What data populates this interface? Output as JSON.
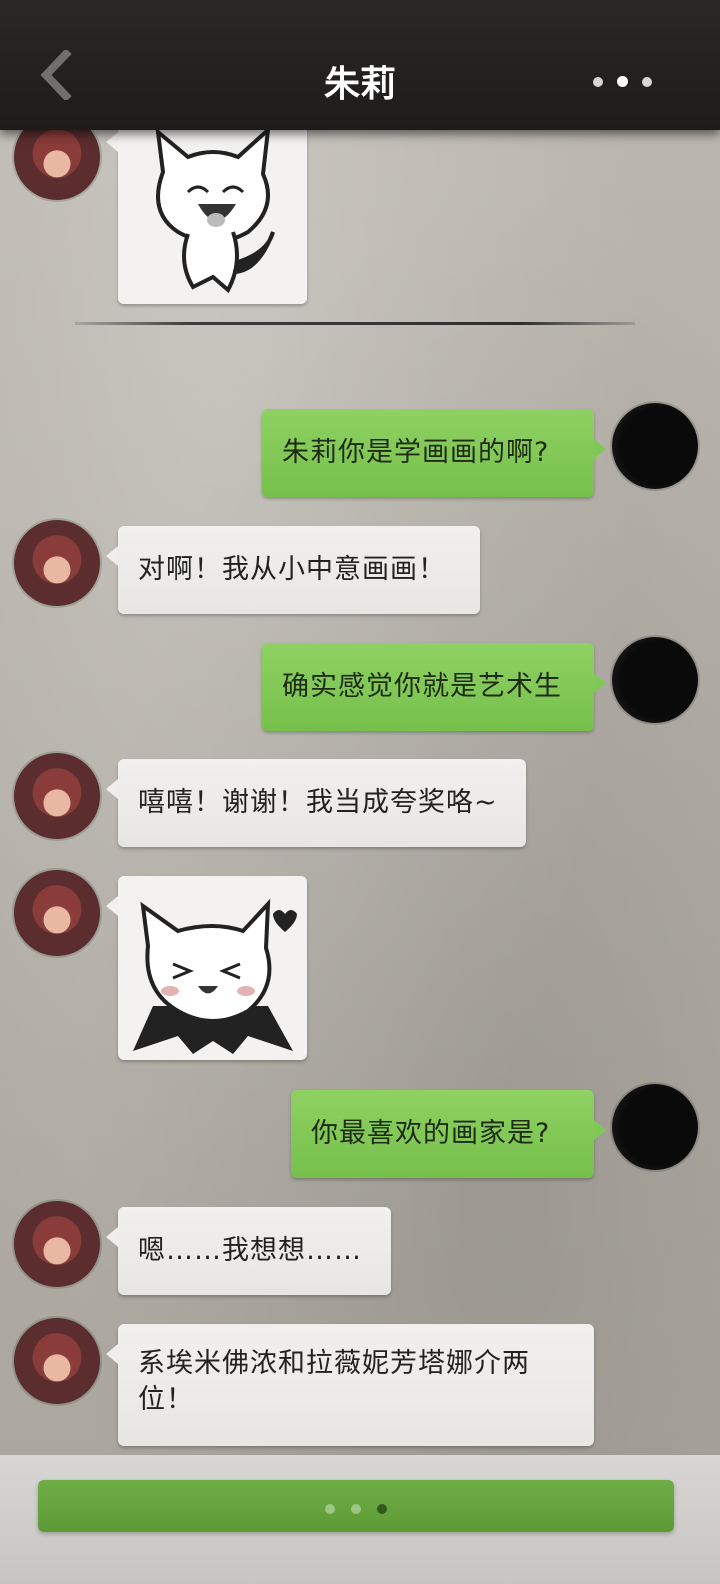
{
  "header": {
    "title": "朱莉",
    "back_icon": "chevron-left-icon",
    "more_icon": "more-dots-icon"
  },
  "messages": [
    {
      "from": "contact",
      "type": "sticker",
      "sticker": "cat-devil-laughing-sticker"
    },
    {
      "from": "me",
      "type": "text",
      "text": "朱莉你是学画画的啊?"
    },
    {
      "from": "contact",
      "type": "text",
      "text": "对啊！我从小中意画画！"
    },
    {
      "from": "me",
      "type": "text",
      "text": "确实感觉你就是艺术生"
    },
    {
      "from": "contact",
      "type": "text",
      "text": "嘻嘻！谢谢！我当成夸奖咯~"
    },
    {
      "from": "contact",
      "type": "sticker",
      "sticker": "cat-devil-happy-heart-sticker"
    },
    {
      "from": "me",
      "type": "text",
      "text": "你最喜欢的画家是?"
    },
    {
      "from": "contact",
      "type": "text",
      "text": "嗯……我想想……"
    },
    {
      "from": "contact",
      "type": "text",
      "text": "系埃米佛浓和拉薇妮芳塔娜介两位！"
    }
  ],
  "footer": {
    "typing_indicator": "typing-dots-icon"
  },
  "colors": {
    "header_bg": "#1f1e1d",
    "my_bubble": "#80c855",
    "contact_bubble": "#efeeec",
    "footer_bar": "#66a43d"
  }
}
